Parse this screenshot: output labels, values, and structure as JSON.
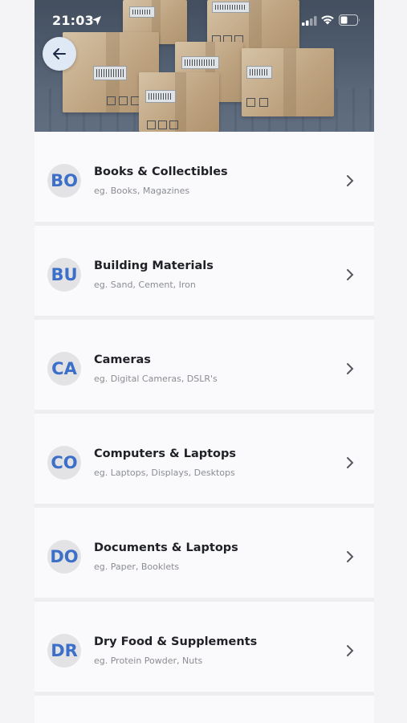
{
  "status_bar": {
    "time": "21:03",
    "icons": [
      "location-arrow-icon",
      "signal-icon",
      "wifi-icon",
      "battery-icon"
    ]
  },
  "hero": {
    "image": "cardboard-boxes-on-laptop-keyboard"
  },
  "back_button": {
    "icon": "arrow-left-icon"
  },
  "categories": [
    {
      "initials": "BO",
      "title": "Books & Collectibles",
      "subtitle": "eg. Books, Magazines"
    },
    {
      "initials": "BU",
      "title": "Building Materials",
      "subtitle": "eg. Sand, Cement, Iron"
    },
    {
      "initials": "CA",
      "title": "Cameras",
      "subtitle": "eg. Digital Cameras, DSLR's"
    },
    {
      "initials": "CO",
      "title": "Computers & Laptops",
      "subtitle": "eg. Laptops, Displays, Desktops"
    },
    {
      "initials": "DO",
      "title": "Documents & Laptops",
      "subtitle": "eg. Paper, Booklets"
    },
    {
      "initials": "DR",
      "title": "Dry Food & Supplements",
      "subtitle": "eg. Protein Powder, Nuts"
    }
  ],
  "colors": {
    "initials_text": "#3c6fc8",
    "avatar_bg": "#e3e3e6",
    "title_text": "#1f2126",
    "subtitle_text": "#8a8d93",
    "row_bg": "#fafafc",
    "back_button_bg": "#dfe8f5"
  }
}
